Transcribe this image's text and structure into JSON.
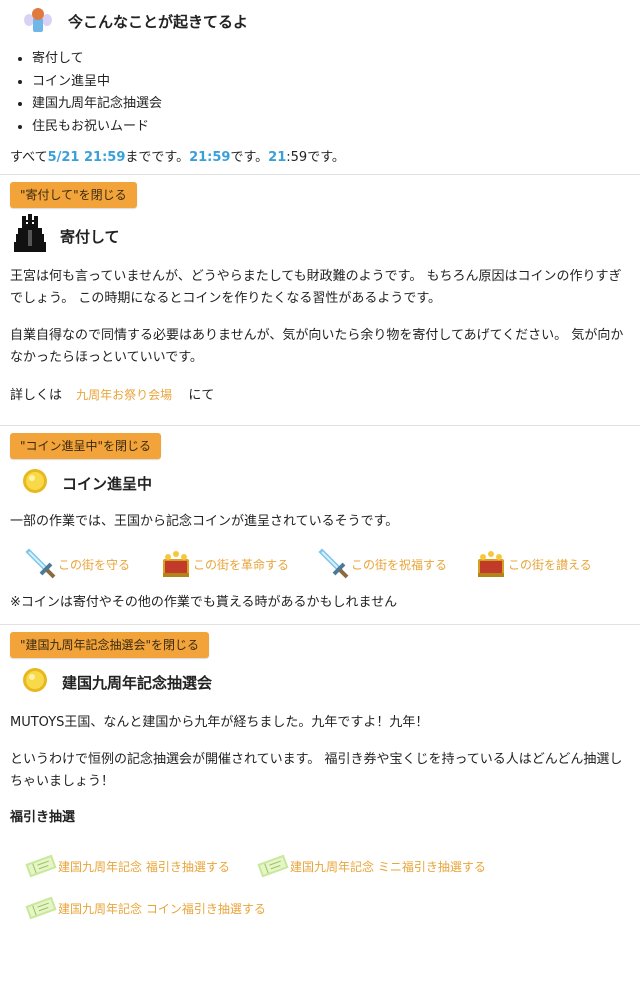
{
  "header": {
    "title": "今こんなことが起きてるよ"
  },
  "events": [
    "寄付して",
    "コイン進呈中",
    "建国九周年記念抽選会",
    "住民もお祝いムード"
  ],
  "deadline": {
    "p1": "すべて",
    "t1": "5/21 21:59",
    "p2": "までです。",
    "t2": "21:59",
    "p3": "です。",
    "t3": "21",
    "p4": ":59です。"
  },
  "donate": {
    "close_label": "\"寄付して\"を閉じる",
    "title": "寄付して",
    "para1": "王宮は何も言っていませんが、どうやらまたしても財政難のようです。 もちろん原因はコインの作りすぎでしょう。 この時期になるとコインを作りたくなる習性があるようです。",
    "para2": "自業自得なので同情する必要はありませんが、気が向いたら余り物を寄付してあげてください。 気が向かなかったらほっといていいです。",
    "details_prefix": "詳しくは",
    "details_link": "九周年お祭り会場",
    "details_suffix": "にて"
  },
  "coin": {
    "close_label": "\"コイン進呈中\"を閉じる",
    "title": "コイン進呈中",
    "para": "一部の作業では、王国から記念コインが進呈されているそうです。",
    "actions": [
      "この街を守る",
      "この街を革命する",
      "この街を祝福する",
      "この街を讃える"
    ],
    "note": "※コインは寄付やその他の作業でも貰える時があるかもしれません"
  },
  "lottery": {
    "close_label": "\"建国九周年記念抽選会\"を閉じる",
    "title": "建国九周年記念抽選会",
    "para1": "MUTOYS王国、なんと建国から九年が経ちました。九年ですよ！九年！",
    "para2": "というわけで恒例の記念抽選会が開催されています。 福引き券や宝くじを持っている人はどんどん抽選しちゃいましょう！",
    "sub_title": "福引き抽選",
    "actions": [
      "建国九周年記念 福引き抽選する",
      "建国九周年記念 ミニ福引き抽選する",
      "建国九周年記念 コイン福引き抽選する"
    ]
  },
  "colors": {
    "accent": "#f2a33a",
    "link": "#e8a53a",
    "time": "#3aa0d8"
  }
}
